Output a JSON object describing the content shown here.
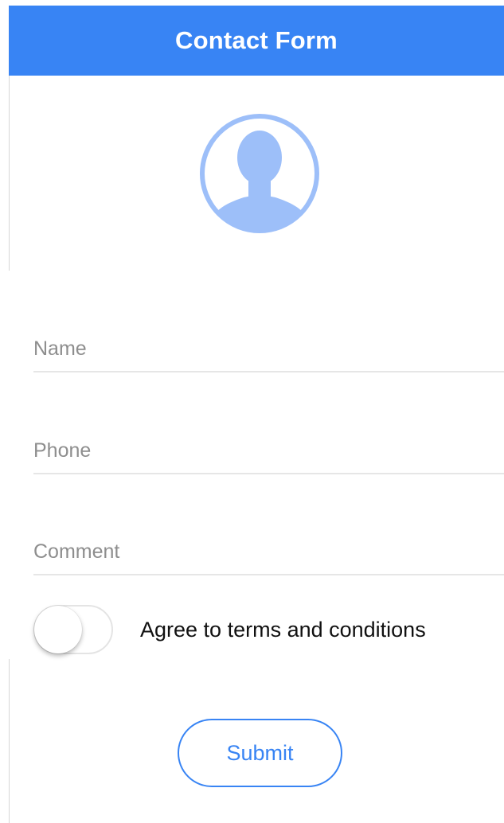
{
  "header": {
    "title": "Contact Form"
  },
  "avatar": {
    "icon": "person-silhouette-icon",
    "color": "#9dbff9"
  },
  "form": {
    "fields": [
      {
        "placeholder": "Name",
        "value": ""
      },
      {
        "placeholder": "Phone",
        "value": ""
      },
      {
        "placeholder": "Comment",
        "value": ""
      }
    ],
    "terms": {
      "label": "Agree to terms and conditions",
      "checked": false
    },
    "submit_label": "Submit"
  },
  "colors": {
    "accent": "#3884f4",
    "avatar": "#9dbff9",
    "divider": "#e6e6e6"
  }
}
